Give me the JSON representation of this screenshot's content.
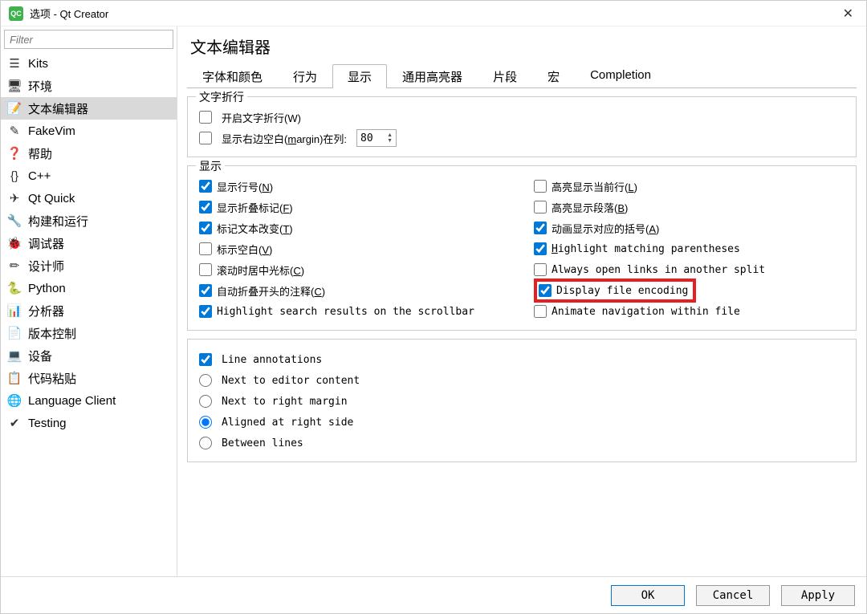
{
  "window": {
    "title": "选项 - Qt Creator"
  },
  "sidebar": {
    "filter_placeholder": "Filter",
    "items": [
      {
        "label": "Kits",
        "icon": "kits"
      },
      {
        "label": "环境",
        "icon": "env"
      },
      {
        "label": "文本编辑器",
        "icon": "text",
        "selected": true
      },
      {
        "label": "FakeVim",
        "icon": "vim"
      },
      {
        "label": "帮助",
        "icon": "help"
      },
      {
        "label": "C++",
        "icon": "cpp"
      },
      {
        "label": "Qt Quick",
        "icon": "quick"
      },
      {
        "label": "构建和运行",
        "icon": "build"
      },
      {
        "label": "调试器",
        "icon": "debug"
      },
      {
        "label": "设计师",
        "icon": "design"
      },
      {
        "label": "Python",
        "icon": "python"
      },
      {
        "label": "分析器",
        "icon": "analyzer"
      },
      {
        "label": "版本控制",
        "icon": "vcs"
      },
      {
        "label": "设备",
        "icon": "device"
      },
      {
        "label": "代码粘贴",
        "icon": "paste"
      },
      {
        "label": "Language Client",
        "icon": "lang"
      },
      {
        "label": "Testing",
        "icon": "test"
      }
    ]
  },
  "page": {
    "title": "文本编辑器",
    "tabs": [
      "字体和颜色",
      "行为",
      "显示",
      "通用高亮器",
      "片段",
      "宏",
      "Completion"
    ],
    "active_tab": "显示"
  },
  "groups": {
    "wrap": {
      "title": "文字折行",
      "enable_wrap": "开启文字折行(W)",
      "show_margin_prefix": "显示右边空白(",
      "show_margin_u": "m",
      "show_margin_suffix": "argin)在列:",
      "margin_col": "80"
    },
    "display": {
      "title": "显示",
      "left": [
        {
          "label": "显示行号(",
          "u": "N",
          "suf": ")",
          "checked": true
        },
        {
          "label": "显示折叠标记(",
          "u": "F",
          "suf": ")",
          "checked": true
        },
        {
          "label": "标记文本改变(",
          "u": "T",
          "suf": ")",
          "checked": true
        },
        {
          "label": "标示空白(",
          "u": "V",
          "suf": ")",
          "checked": false
        },
        {
          "label": "滚动时居中光标(",
          "u": "C",
          "suf": ")",
          "checked": false
        },
        {
          "label": "自动折叠开头的注释(",
          "u": "C",
          "suf": ")",
          "checked": true
        },
        {
          "label": "Highlight search results on the scrollbar",
          "checked": true,
          "plain": true
        }
      ],
      "right": [
        {
          "label": "高亮显示当前行(",
          "u": "L",
          "suf": ")",
          "checked": false
        },
        {
          "label": "高亮显示段落(",
          "u": "B",
          "suf": ")",
          "checked": false
        },
        {
          "label": "动画显示对应的括号(",
          "u": "A",
          "suf": ")",
          "checked": true
        },
        {
          "pre": "H",
          "label": "ighlight matching parentheses",
          "checked": true,
          "plain": true
        },
        {
          "label": "Always open links in another split",
          "checked": false,
          "plain": true
        },
        {
          "label": "Display file encoding",
          "checked": true,
          "plain": true,
          "highlight": true
        },
        {
          "label": "Animate navigation within file",
          "checked": false,
          "plain": true
        }
      ]
    },
    "annotations": {
      "checkbox_label": "Line annotations",
      "checked": true,
      "radios": [
        {
          "label": "Next to editor content",
          "value": "content"
        },
        {
          "label": "Next to right margin",
          "value": "margin"
        },
        {
          "label": "Aligned at right side",
          "value": "right",
          "selected": true
        },
        {
          "label": "Between lines",
          "value": "between"
        }
      ]
    }
  },
  "footer": {
    "ok": "OK",
    "cancel": "Cancel",
    "apply": "Apply"
  },
  "icons": {
    "kits": "☰",
    "env": "🖥",
    "text": "📝",
    "vim": "✎",
    "help": "❓",
    "cpp": "{}",
    "quick": "✈",
    "build": "🔧",
    "debug": "🐞",
    "design": "✏",
    "python": "🐍",
    "analyzer": "📊",
    "vcs": "📄",
    "device": "💻",
    "paste": "📋",
    "lang": "🌐",
    "test": "✔"
  }
}
